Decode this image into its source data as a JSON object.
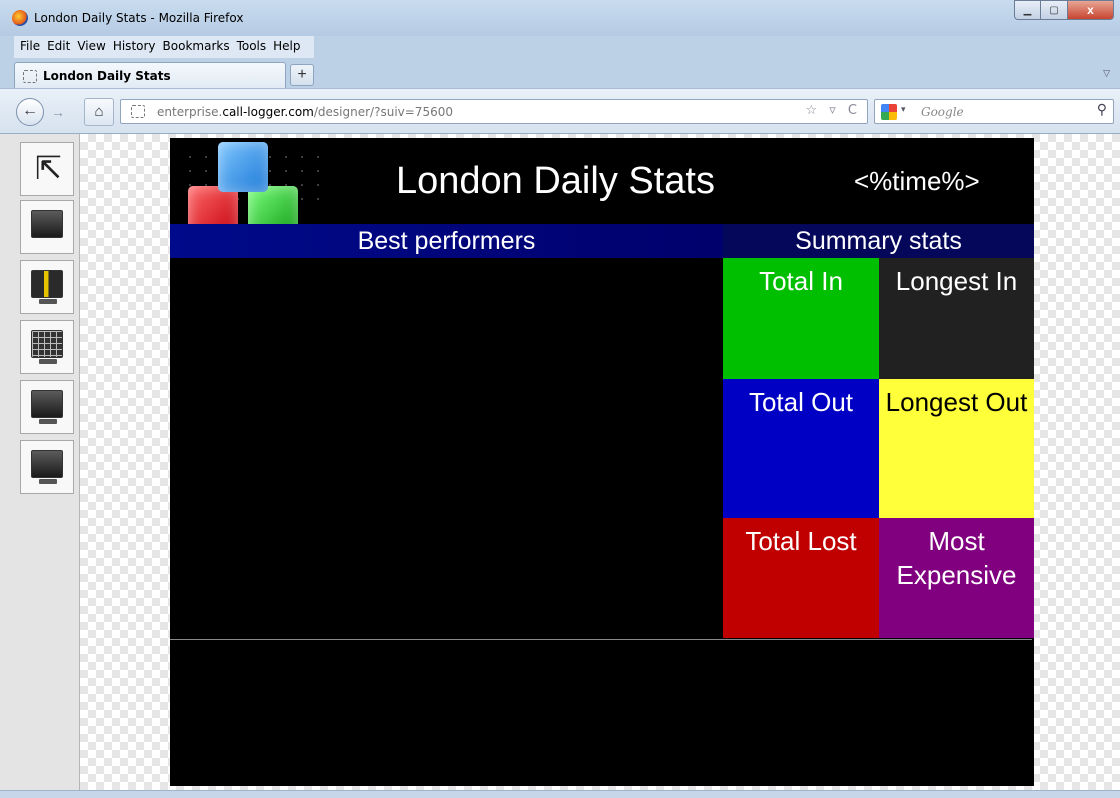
{
  "window": {
    "title": "London Daily Stats - Mozilla Firefox",
    "min_icon": "minimize-icon",
    "max_icon": "maximize-icon",
    "close_label": "x"
  },
  "menubar": {
    "items": [
      "File",
      "Edit",
      "View",
      "History",
      "Bookmarks",
      "Tools",
      "Help"
    ]
  },
  "tabs": [
    {
      "label": "London Daily Stats",
      "active": true
    }
  ],
  "newtab_label": "+",
  "navbar": {
    "back_glyph": "←",
    "forward_glyph": "→",
    "home_glyph": "⌂",
    "url_prefix": "enterprise.",
    "url_domain": "call-logger.com",
    "url_path": "/designer/?suiv=75600",
    "url_right_glyphs": "☆ ▿ C",
    "search_placeholder": "Google",
    "search_icon": "magnifier-icon"
  },
  "toolbox": {
    "tools": [
      {
        "name": "pointer-tool",
        "icon": "cursor-arrow-icon"
      },
      {
        "name": "video-tool",
        "icon": "video-player-icon"
      },
      {
        "name": "gauge-tool",
        "icon": "monitor-gauge-icon"
      },
      {
        "name": "grid-tool",
        "icon": "monitor-grid-icon"
      },
      {
        "name": "list-tool",
        "icon": "monitor-list-icon"
      },
      {
        "name": "save-tool",
        "icon": "monitor-disk-icon"
      }
    ]
  },
  "dashboard": {
    "title": "London Daily Stats",
    "time_placeholder": "<%time%>",
    "best_performers_label": "Best performers",
    "summary_label": "Summary stats",
    "tiles": {
      "total_in": "Total In",
      "longest_in": "Longest In",
      "total_out": "Total Out",
      "longest_out": "Longest Out",
      "total_lost": "Total Lost",
      "most_expensive": "Most Expensive"
    },
    "colors": {
      "total_in": "#00bf00",
      "longest_in": "#212121",
      "total_out": "#0000c4",
      "longest_out": "#ffff3a",
      "total_lost": "#c00000",
      "most_expensive": "#800080",
      "header_blue": "#000a8a"
    }
  }
}
